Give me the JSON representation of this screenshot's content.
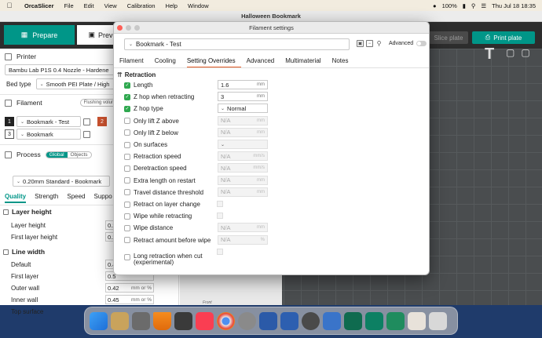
{
  "menubar": {
    "app_name": "OrcaSlicer",
    "items": [
      "File",
      "Edit",
      "View",
      "Calibration",
      "Help",
      "Window"
    ],
    "battery": "100%",
    "clock": "Thu Jul 18  18:35"
  },
  "window": {
    "title": "Halloween Bookmark",
    "tab_prepare": "Prepare",
    "tab_preview": "Prev",
    "slice_label": "Slice plate",
    "print_label": "Print plate"
  },
  "left": {
    "printer_title": "Printer",
    "printer_preset": "Bambu Lab P1S 0.4 Nozzle - Hardene",
    "bed_type_label": "Bed type",
    "bed_type_value": "Smooth PEI Plate / High",
    "filament_title": "Filament",
    "flushing_label": "Flushing volumes",
    "filaments": [
      {
        "num": "1",
        "name": "Bookmark - Test",
        "extra": "2"
      },
      {
        "num": "3",
        "name": "Bookmark"
      }
    ],
    "process_title": "Process",
    "global_label": "Global",
    "objects_label": "Objects",
    "process_preset": "0.20mm Standard - Bookmark",
    "tabs": [
      "Quality",
      "Strength",
      "Speed",
      "Suppo"
    ],
    "layer_height_group": "Layer height",
    "layer_height": {
      "label": "Layer height",
      "value": "0.2"
    },
    "first_layer_height": {
      "label": "First layer height",
      "value": "0.2"
    },
    "line_width_group": "Line width",
    "line_rows": [
      {
        "label": "Default",
        "value": "0.4",
        "unit": ""
      },
      {
        "label": "First layer",
        "value": "0.5",
        "unit": ""
      },
      {
        "label": "Outer wall",
        "value": "0.42",
        "unit": "mm or %"
      },
      {
        "label": "Inner wall",
        "value": "0.45",
        "unit": "mm or %"
      },
      {
        "label": "Top surface",
        "value": "0.42",
        "unit": "mm or %"
      }
    ]
  },
  "canvas": {
    "plate_label": "Front"
  },
  "dialog": {
    "title": "Filament settings",
    "preset": "Bookmark - Test",
    "advanced_label": "Advanced",
    "advanced_on": false,
    "tabs": [
      "Filament",
      "Cooling",
      "Setting Overrides",
      "Advanced",
      "Multimaterial",
      "Notes"
    ],
    "active_tab": "Setting Overrides",
    "section": "Retraction",
    "options": [
      {
        "label": "Length",
        "checked": true,
        "value": "1.6",
        "unit": "mm",
        "kind": "field"
      },
      {
        "label": "Z hop when retracting",
        "checked": true,
        "value": "3",
        "unit": "mm",
        "kind": "field"
      },
      {
        "label": "Z hop type",
        "checked": true,
        "value": "Normal",
        "unit": "",
        "kind": "select"
      },
      {
        "label": "Only lift Z above",
        "checked": false,
        "value": "N/A",
        "unit": "mm",
        "kind": "field"
      },
      {
        "label": "Only lift Z below",
        "checked": false,
        "value": "N/A",
        "unit": "mm",
        "kind": "field"
      },
      {
        "label": "On surfaces",
        "checked": false,
        "value": "",
        "unit": "",
        "kind": "select"
      },
      {
        "label": "Retraction speed",
        "checked": false,
        "value": "N/A",
        "unit": "mm/s",
        "kind": "field"
      },
      {
        "label": "Deretraction speed",
        "checked": false,
        "value": "N/A",
        "unit": "mm/s",
        "kind": "field"
      },
      {
        "label": "Extra length on restart",
        "checked": false,
        "value": "N/A",
        "unit": "mm",
        "kind": "field"
      },
      {
        "label": "Travel distance threshold",
        "checked": false,
        "value": "N/A",
        "unit": "mm",
        "kind": "field"
      },
      {
        "label": "Retract on layer change",
        "checked": false,
        "value": "",
        "unit": "",
        "kind": "box"
      },
      {
        "label": "Wipe while retracting",
        "checked": false,
        "value": "",
        "unit": "",
        "kind": "box"
      },
      {
        "label": "Wipe distance",
        "checked": false,
        "value": "N/A",
        "unit": "mm",
        "kind": "field"
      },
      {
        "label": "Retract amount before wipe",
        "checked": false,
        "value": "N/A",
        "unit": "%",
        "kind": "field"
      },
      {
        "label": "Long retraction when cut (experimental)",
        "checked": false,
        "value": "",
        "unit": "",
        "kind": "box"
      }
    ]
  },
  "colors": {
    "accent": "#009688",
    "tab_underline": "#e25a24",
    "check_green": "#2fa84f"
  }
}
